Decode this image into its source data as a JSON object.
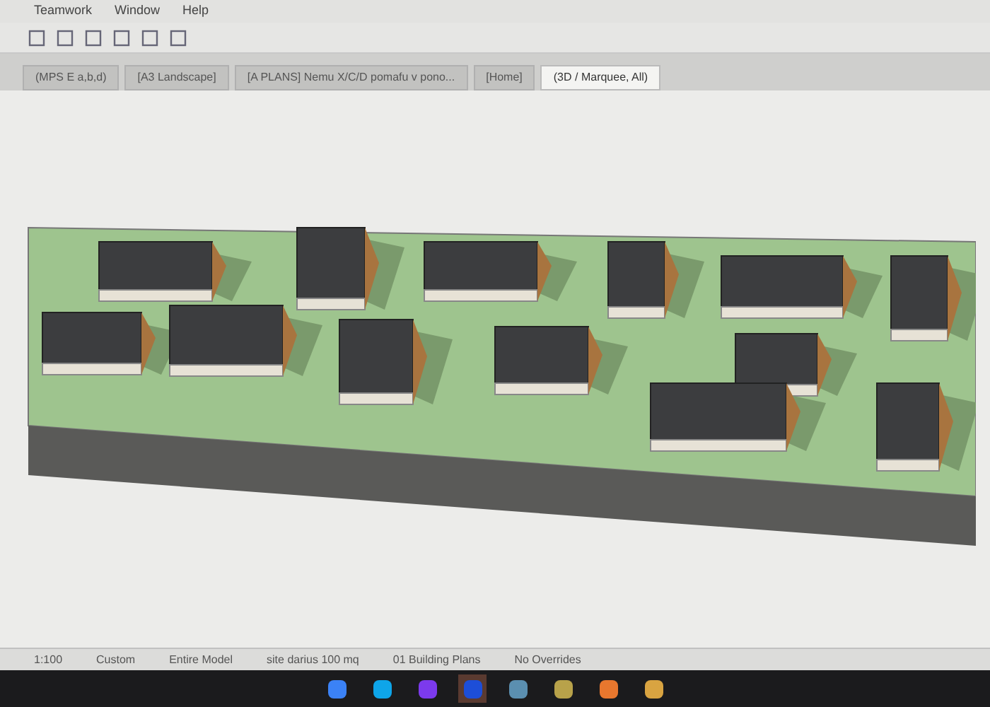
{
  "menu_bar": {
    "items": [
      "Teamwork",
      "Window",
      "Help"
    ]
  },
  "tabs": [
    {
      "label": "(MPS E a,b,d)",
      "selected": false
    },
    {
      "label": "[A3 Landscape]",
      "selected": false
    },
    {
      "label": "[A PLANS] Nemu X/C/D pomafu v pono...",
      "selected": false
    },
    {
      "label": "[Home]",
      "selected": false
    },
    {
      "label": "(3D / Marquee, All)",
      "selected": true
    }
  ],
  "status_bar": {
    "items": [
      "1:100",
      "Custom",
      "Entire Model",
      "site darius 100 mq",
      "01 Building Plans",
      "No Overrides"
    ]
  },
  "taskbar": {
    "apps": [
      {
        "color": "#3b82f6",
        "selected": false
      },
      {
        "color": "#0ea5e9",
        "selected": false
      },
      {
        "color": "#7c3aed",
        "selected": false
      },
      {
        "color": "#1d4ed8",
        "selected": true
      },
      {
        "color": "#5b8fb0",
        "selected": false
      },
      {
        "color": "#b8a24a",
        "selected": false
      },
      {
        "color": "#e8772e",
        "selected": false
      },
      {
        "color": "#d9a441",
        "selected": false
      }
    ]
  }
}
